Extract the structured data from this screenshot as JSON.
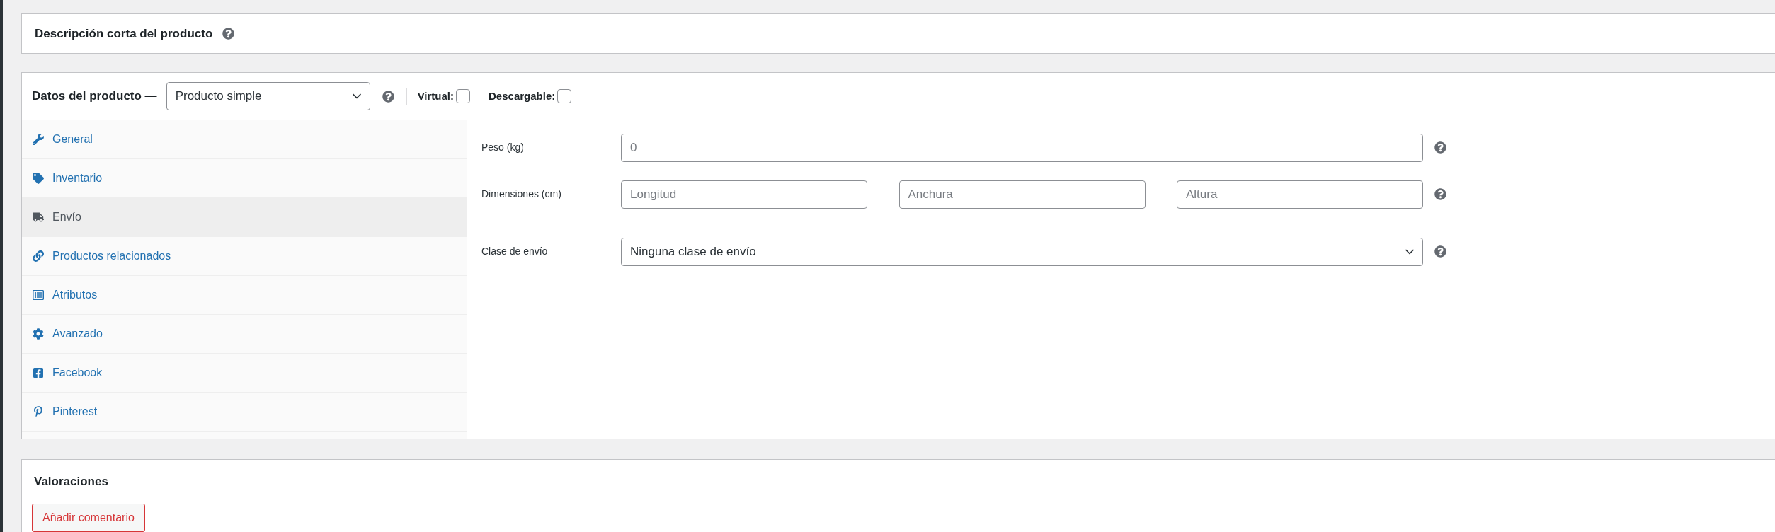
{
  "short_description_panel": {
    "title": "Descripción corta del producto"
  },
  "product_data": {
    "title": "Datos del producto —",
    "product_type": "Producto simple",
    "virtual": {
      "label": "Virtual:",
      "checked": false
    },
    "downloadable": {
      "label": "Descargable:",
      "checked": false
    },
    "tabs": [
      {
        "label": "General",
        "kind": "wrench",
        "selected": false
      },
      {
        "label": "Inventario",
        "kind": "tag",
        "selected": false
      },
      {
        "label": "Envío",
        "kind": "truck",
        "selected": true
      },
      {
        "label": "Productos relacionados",
        "kind": "link",
        "selected": false
      },
      {
        "label": "Atributos",
        "kind": "list",
        "selected": false
      },
      {
        "label": "Avanzado",
        "kind": "gear",
        "selected": false
      },
      {
        "label": "Facebook",
        "kind": "facebook",
        "selected": false
      },
      {
        "label": "Pinterest",
        "kind": "pinterest",
        "selected": false
      }
    ],
    "weight": {
      "label": "Peso (kg)",
      "placeholder": "0"
    },
    "dimensions": {
      "label": "Dimensiones (cm)",
      "placeholders": [
        "Longitud",
        "Anchura",
        "Altura"
      ]
    },
    "shipping_class": {
      "label": "Clase de envío",
      "value": "Ninguna clase de envío"
    }
  },
  "reviews": {
    "title": "Valoraciones",
    "button": "Añadir comentario"
  }
}
